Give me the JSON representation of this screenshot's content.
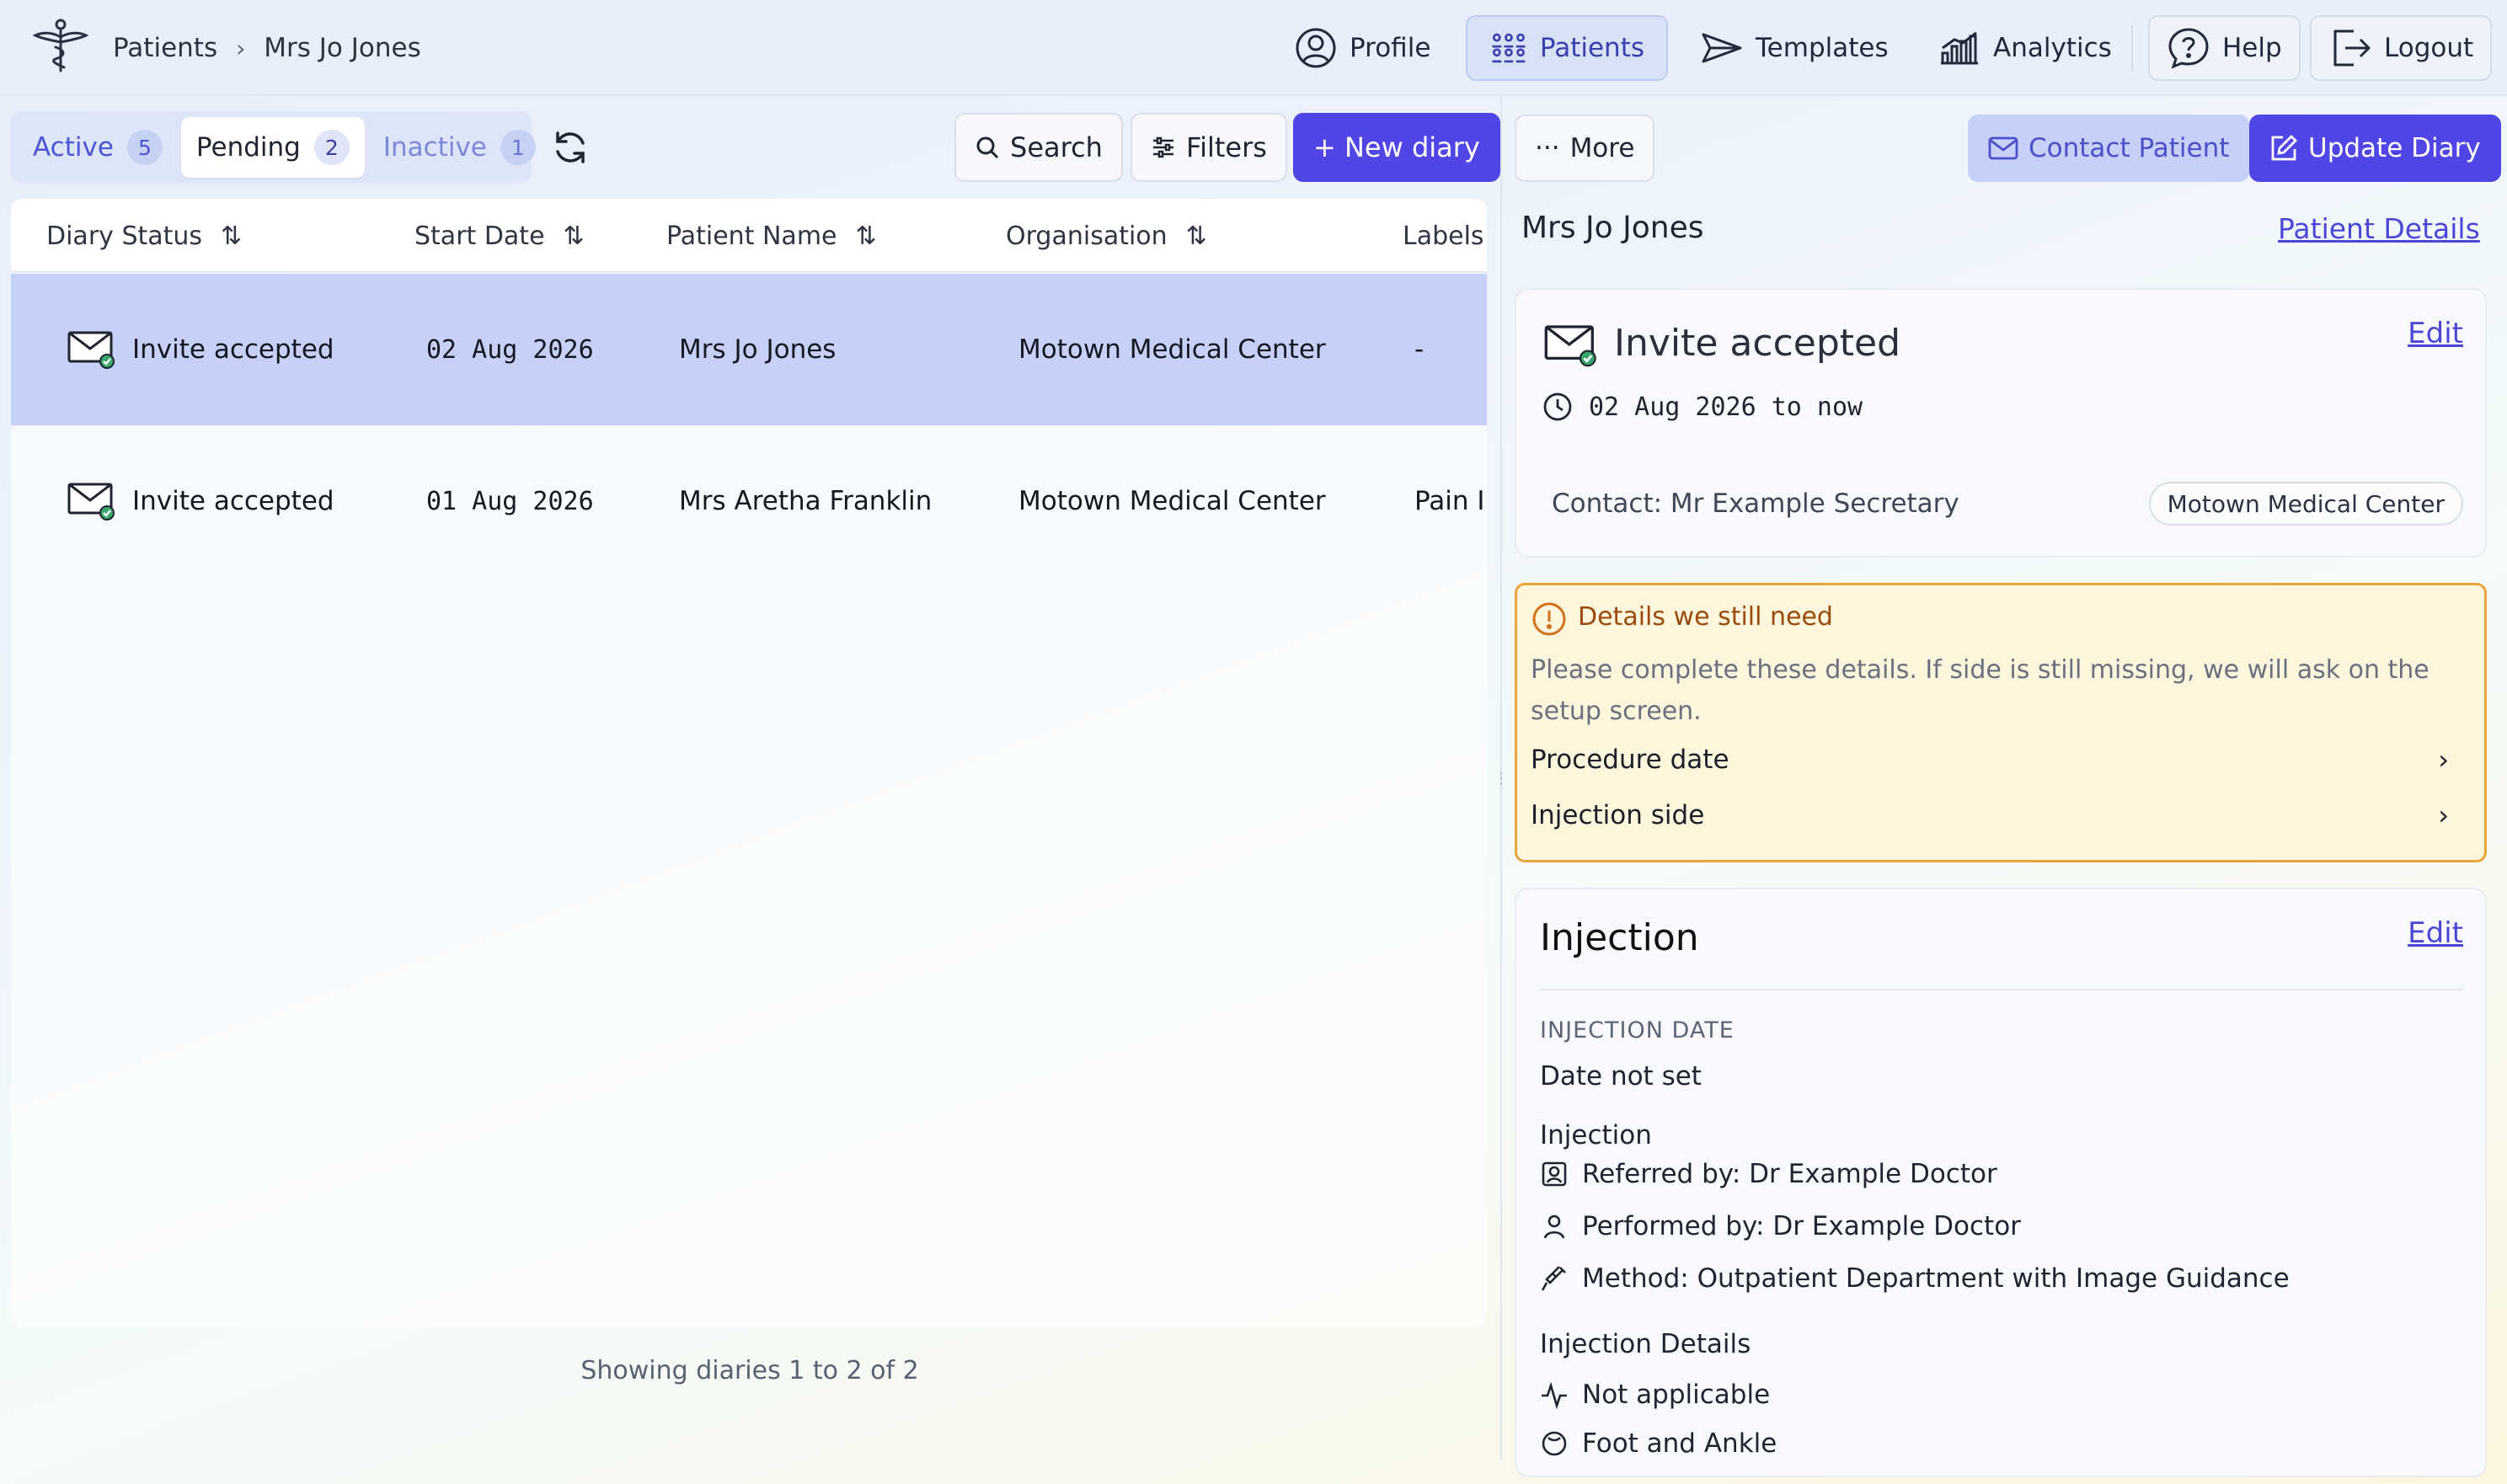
{
  "breadcrumb": {
    "root": "Patients",
    "current": "Mrs Jo Jones"
  },
  "nav": {
    "profile": "Profile",
    "patients": "Patients",
    "templates": "Templates",
    "analytics": "Analytics",
    "help": "Help",
    "logout": "Logout"
  },
  "tabs": {
    "active": {
      "label": "Active",
      "count": "5"
    },
    "pending": {
      "label": "Pending",
      "count": "2"
    },
    "inactive": {
      "label": "Inactive",
      "count": "1"
    }
  },
  "toolbar": {
    "search": "Search",
    "filters": "Filters",
    "new_diary": "+ New diary"
  },
  "table": {
    "headers": {
      "status": "Diary Status",
      "start": "Start Date",
      "patient": "Patient Name",
      "org": "Organisation",
      "labels": "Labels"
    },
    "rows": [
      {
        "status": "Invite accepted",
        "start": "02 Aug 2026",
        "patient": "Mrs Jo Jones",
        "org": "Motown Medical Center",
        "labels": "-"
      },
      {
        "status": "Invite accepted",
        "start": "01 Aug 2026",
        "patient": "Mrs Aretha Franklin",
        "org": "Motown Medical Center",
        "labels": "Pain I"
      }
    ],
    "footer": "Showing diaries 1 to 2 of 2"
  },
  "detail": {
    "more": "More",
    "contact_patient": "Contact Patient",
    "update_diary": "Update Diary",
    "patient_name": "Mrs Jo Jones",
    "patient_details": "Patient Details",
    "status": {
      "title": "Invite accepted",
      "edit": "Edit",
      "date_range": "02 Aug 2026 to now",
      "contact": "Contact: Mr Example Secretary",
      "organisation": "Motown Medical Center"
    },
    "warning": {
      "title": "Details we still need",
      "text": "Please complete these details. If side is still missing, we will ask on the setup screen.",
      "items": [
        "Procedure date",
        "Injection side"
      ]
    },
    "injection": {
      "title": "Injection",
      "edit": "Edit",
      "date_label": "INJECTION DATE",
      "date_value": "Date not set",
      "section_label": "Injection",
      "referred_by": "Referred by: Dr Example Doctor",
      "performed_by": "Performed by: Dr Example Doctor",
      "method": "Method: Outpatient Department with Image Guidance",
      "details_label": "Injection Details",
      "detail_1": "Not applicable",
      "detail_2": "Foot and Ankle"
    }
  },
  "colors": {
    "primary": "#4f46e5",
    "selected_row": "#c6d0f8",
    "warning_border": "#e8a53c",
    "link": "#4b46d6"
  }
}
